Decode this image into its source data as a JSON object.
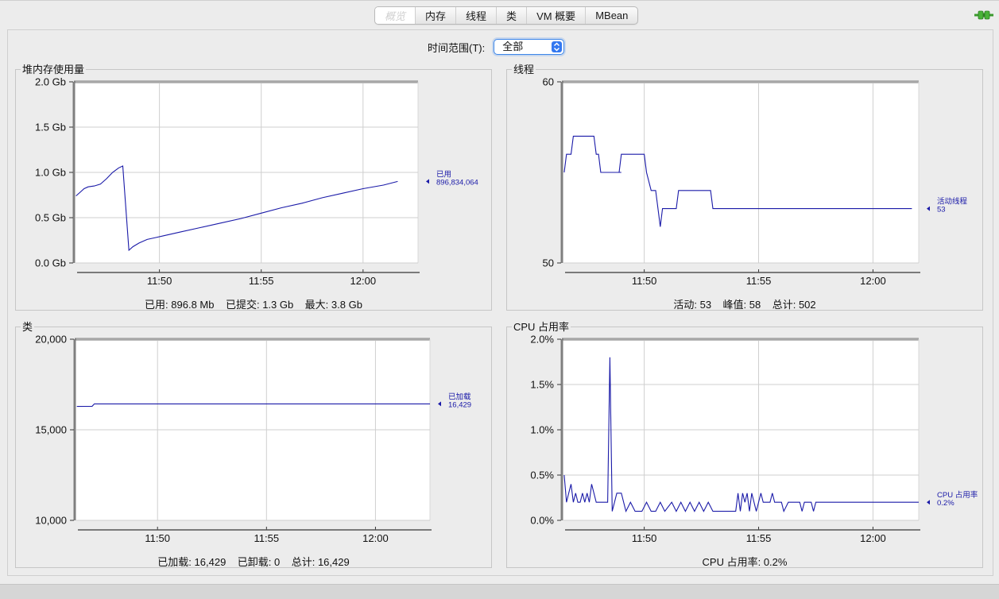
{
  "tabs": [
    {
      "id": "overview",
      "label": "概览",
      "selected": true
    },
    {
      "id": "memory",
      "label": "内存",
      "selected": false
    },
    {
      "id": "threads",
      "label": "线程",
      "selected": false
    },
    {
      "id": "classes",
      "label": "类",
      "selected": false
    },
    {
      "id": "vm",
      "label": "VM 概要",
      "selected": false
    },
    {
      "id": "mbean",
      "label": "MBean",
      "selected": false
    }
  ],
  "time_range": {
    "label": "时间范围(T):",
    "value": "全部"
  },
  "colors": {
    "series": "#1a1aa8",
    "grid": "#cfcfcf",
    "frame": "#7f7f7f"
  },
  "icons": {
    "connection": "connection-plug-icon",
    "select": "select-arrows-icon"
  },
  "chart_data": [
    {
      "id": "heap",
      "type": "line",
      "title": "堆内存使用量",
      "ylim": [
        0,
        2.0
      ],
      "yticks": [
        {
          "v": 0,
          "label": "0.0 Gb"
        },
        {
          "v": 0.5,
          "label": "0.5 Gb"
        },
        {
          "v": 1.0,
          "label": "1.0 Gb"
        },
        {
          "v": 1.5,
          "label": "1.5 Gb"
        },
        {
          "v": 2.0,
          "label": "2.0 Gb"
        }
      ],
      "xlim": [
        -4.2,
        12.7
      ],
      "xticks": [
        {
          "v": 0,
          "label": "11:50"
        },
        {
          "v": 5,
          "label": "11:55"
        },
        {
          "v": 10,
          "label": "12:00"
        }
      ],
      "series": [
        {
          "name": "已用",
          "value_label": "896,834,064",
          "points": [
            [
              -4.1,
              0.74
            ],
            [
              -3.9,
              0.78
            ],
            [
              -3.7,
              0.82
            ],
            [
              -3.5,
              0.84
            ],
            [
              -3.2,
              0.85
            ],
            [
              -2.9,
              0.87
            ],
            [
              -2.6,
              0.93
            ],
            [
              -2.3,
              1.0
            ],
            [
              -2.0,
              1.05
            ],
            [
              -1.8,
              1.07
            ],
            [
              -1.5,
              0.14
            ],
            [
              -1.3,
              0.18
            ],
            [
              -1.0,
              0.22
            ],
            [
              -0.6,
              0.26
            ],
            [
              -0.2,
              0.28
            ],
            [
              0.2,
              0.3
            ],
            [
              1,
              0.34
            ],
            [
              2,
              0.39
            ],
            [
              3,
              0.44
            ],
            [
              4,
              0.49
            ],
            [
              5,
              0.55
            ],
            [
              6,
              0.61
            ],
            [
              7,
              0.66
            ],
            [
              8,
              0.72
            ],
            [
              9,
              0.77
            ],
            [
              10,
              0.82
            ],
            [
              11,
              0.86
            ],
            [
              11.7,
              0.9
            ]
          ]
        }
      ],
      "summary": [
        {
          "label": "已用:",
          "value": "896.8 Mb"
        },
        {
          "label": "已提交:",
          "value": "1.3 Gb"
        },
        {
          "label": "最大:",
          "value": "3.8 Gb"
        }
      ]
    },
    {
      "id": "threads",
      "type": "line",
      "title": "线程",
      "ylim": [
        50,
        60
      ],
      "yticks": [
        {
          "v": 50,
          "label": "50"
        },
        {
          "v": 60,
          "label": "60"
        }
      ],
      "xlim": [
        -3.6,
        12.0
      ],
      "xticks": [
        {
          "v": 0,
          "label": "11:50"
        },
        {
          "v": 5,
          "label": "11:55"
        },
        {
          "v": 10,
          "label": "12:00"
        }
      ],
      "series": [
        {
          "name": "活动线程",
          "value_label": "53",
          "points": [
            [
              -3.5,
              55
            ],
            [
              -3.4,
              56
            ],
            [
              -3.2,
              56
            ],
            [
              -3.1,
              57
            ],
            [
              -2.2,
              57
            ],
            [
              -2.1,
              56
            ],
            [
              -2.0,
              56
            ],
            [
              -1.9,
              55
            ],
            [
              -1.0,
              55
            ],
            [
              -1.1,
              55
            ],
            [
              -1.2,
              55
            ],
            [
              -1.0,
              55
            ],
            [
              -1.1,
              55
            ],
            [
              -1.2,
              55
            ],
            [
              -1.15,
              55
            ],
            [
              -1.2,
              55
            ],
            [
              -1.1,
              55
            ],
            [
              -1.0,
              56
            ],
            [
              0,
              56
            ],
            [
              0.1,
              55
            ],
            [
              0.3,
              54
            ],
            [
              0.5,
              54
            ],
            [
              0.6,
              53
            ],
            [
              0.7,
              52
            ],
            [
              0.8,
              53
            ],
            [
              1.2,
              53
            ],
            [
              1.4,
              53
            ],
            [
              1.5,
              54
            ],
            [
              2.9,
              54
            ],
            [
              3.0,
              53
            ],
            [
              11.7,
              53
            ]
          ]
        }
      ],
      "summary": [
        {
          "label": "活动:",
          "value": "53"
        },
        {
          "label": "峰值:",
          "value": "58"
        },
        {
          "label": "总计:",
          "value": "502"
        }
      ]
    },
    {
      "id": "classes",
      "type": "line",
      "title": "类",
      "ylim": [
        10000,
        20000
      ],
      "yticks": [
        {
          "v": 10000,
          "label": "10,000"
        },
        {
          "v": 15000,
          "label": "15,000"
        },
        {
          "v": 20000,
          "label": "20,000"
        }
      ],
      "xlim": [
        -3.8,
        12.5
      ],
      "xticks": [
        {
          "v": 0,
          "label": "11:50"
        },
        {
          "v": 5,
          "label": "11:55"
        },
        {
          "v": 10,
          "label": "12:00"
        }
      ],
      "series": [
        {
          "name": "已加载",
          "value_label": "16,429",
          "points": [
            [
              -3.7,
              16290
            ],
            [
              -3.0,
              16300
            ],
            [
              -2.9,
              16429
            ],
            [
              12.5,
              16429
            ]
          ]
        }
      ],
      "summary": [
        {
          "label": "已加载:",
          "value": "16,429"
        },
        {
          "label": "已卸载:",
          "value": "0"
        },
        {
          "label": "总计:",
          "value": "16,429"
        }
      ]
    },
    {
      "id": "cpu",
      "type": "line",
      "title": "CPU 占用率",
      "ylim": [
        0,
        2.0
      ],
      "yticks": [
        {
          "v": 0,
          "label": "0.0%"
        },
        {
          "v": 0.5,
          "label": "0.5%"
        },
        {
          "v": 1.0,
          "label": "1.0%"
        },
        {
          "v": 1.5,
          "label": "1.5%"
        },
        {
          "v": 2.0,
          "label": "2.0%"
        }
      ],
      "xlim": [
        -3.6,
        12.0
      ],
      "xticks": [
        {
          "v": 0,
          "label": "11:50"
        },
        {
          "v": 5,
          "label": "11:55"
        },
        {
          "v": 10,
          "label": "12:00"
        }
      ],
      "series": [
        {
          "name": "CPU 占用率",
          "value_label": "0.2%",
          "points": [
            [
              -3.5,
              0.5
            ],
            [
              -3.4,
              0.2
            ],
            [
              -3.3,
              0.3
            ],
            [
              -3.2,
              0.4
            ],
            [
              -3.1,
              0.2
            ],
            [
              -3.0,
              0.3
            ],
            [
              -2.9,
              0.2
            ],
            [
              -2.8,
              0.2
            ],
            [
              -2.7,
              0.3
            ],
            [
              -2.6,
              0.2
            ],
            [
              -2.5,
              0.3
            ],
            [
              -2.4,
              0.2
            ],
            [
              -2.3,
              0.4
            ],
            [
              -2.2,
              0.3
            ],
            [
              -2.1,
              0.2
            ],
            [
              -2.0,
              0.2
            ],
            [
              -1.9,
              0.2
            ],
            [
              -1.6,
              0.2
            ],
            [
              -1.5,
              1.8
            ],
            [
              -1.4,
              0.1
            ],
            [
              -1.3,
              0.2
            ],
            [
              -1.2,
              0.3
            ],
            [
              -1.0,
              0.3
            ],
            [
              -0.8,
              0.1
            ],
            [
              -0.6,
              0.2
            ],
            [
              -0.4,
              0.1
            ],
            [
              -0.1,
              0.1
            ],
            [
              0.1,
              0.2
            ],
            [
              0.3,
              0.1
            ],
            [
              0.5,
              0.1
            ],
            [
              0.7,
              0.2
            ],
            [
              0.9,
              0.1
            ],
            [
              1.2,
              0.2
            ],
            [
              1.4,
              0.1
            ],
            [
              1.6,
              0.2
            ],
            [
              1.8,
              0.1
            ],
            [
              2.0,
              0.2
            ],
            [
              2.2,
              0.1
            ],
            [
              2.4,
              0.2
            ],
            [
              2.6,
              0.1
            ],
            [
              2.8,
              0.2
            ],
            [
              3.0,
              0.1
            ],
            [
              4.0,
              0.1
            ],
            [
              4.1,
              0.3
            ],
            [
              4.2,
              0.1
            ],
            [
              4.3,
              0.3
            ],
            [
              4.4,
              0.2
            ],
            [
              4.5,
              0.3
            ],
            [
              4.6,
              0.1
            ],
            [
              4.7,
              0.3
            ],
            [
              4.9,
              0.1
            ],
            [
              5.1,
              0.3
            ],
            [
              5.2,
              0.2
            ],
            [
              5.5,
              0.2
            ],
            [
              5.6,
              0.3
            ],
            [
              5.7,
              0.2
            ],
            [
              6.0,
              0.2
            ],
            [
              6.1,
              0.1
            ],
            [
              6.3,
              0.2
            ],
            [
              6.8,
              0.2
            ],
            [
              6.9,
              0.1
            ],
            [
              7.0,
              0.2
            ],
            [
              7.3,
              0.2
            ],
            [
              7.4,
              0.1
            ],
            [
              7.5,
              0.2
            ],
            [
              12.0,
              0.2
            ]
          ]
        }
      ],
      "summary": [
        {
          "label": "CPU 占用率:",
          "value": "0.2%"
        }
      ]
    }
  ]
}
